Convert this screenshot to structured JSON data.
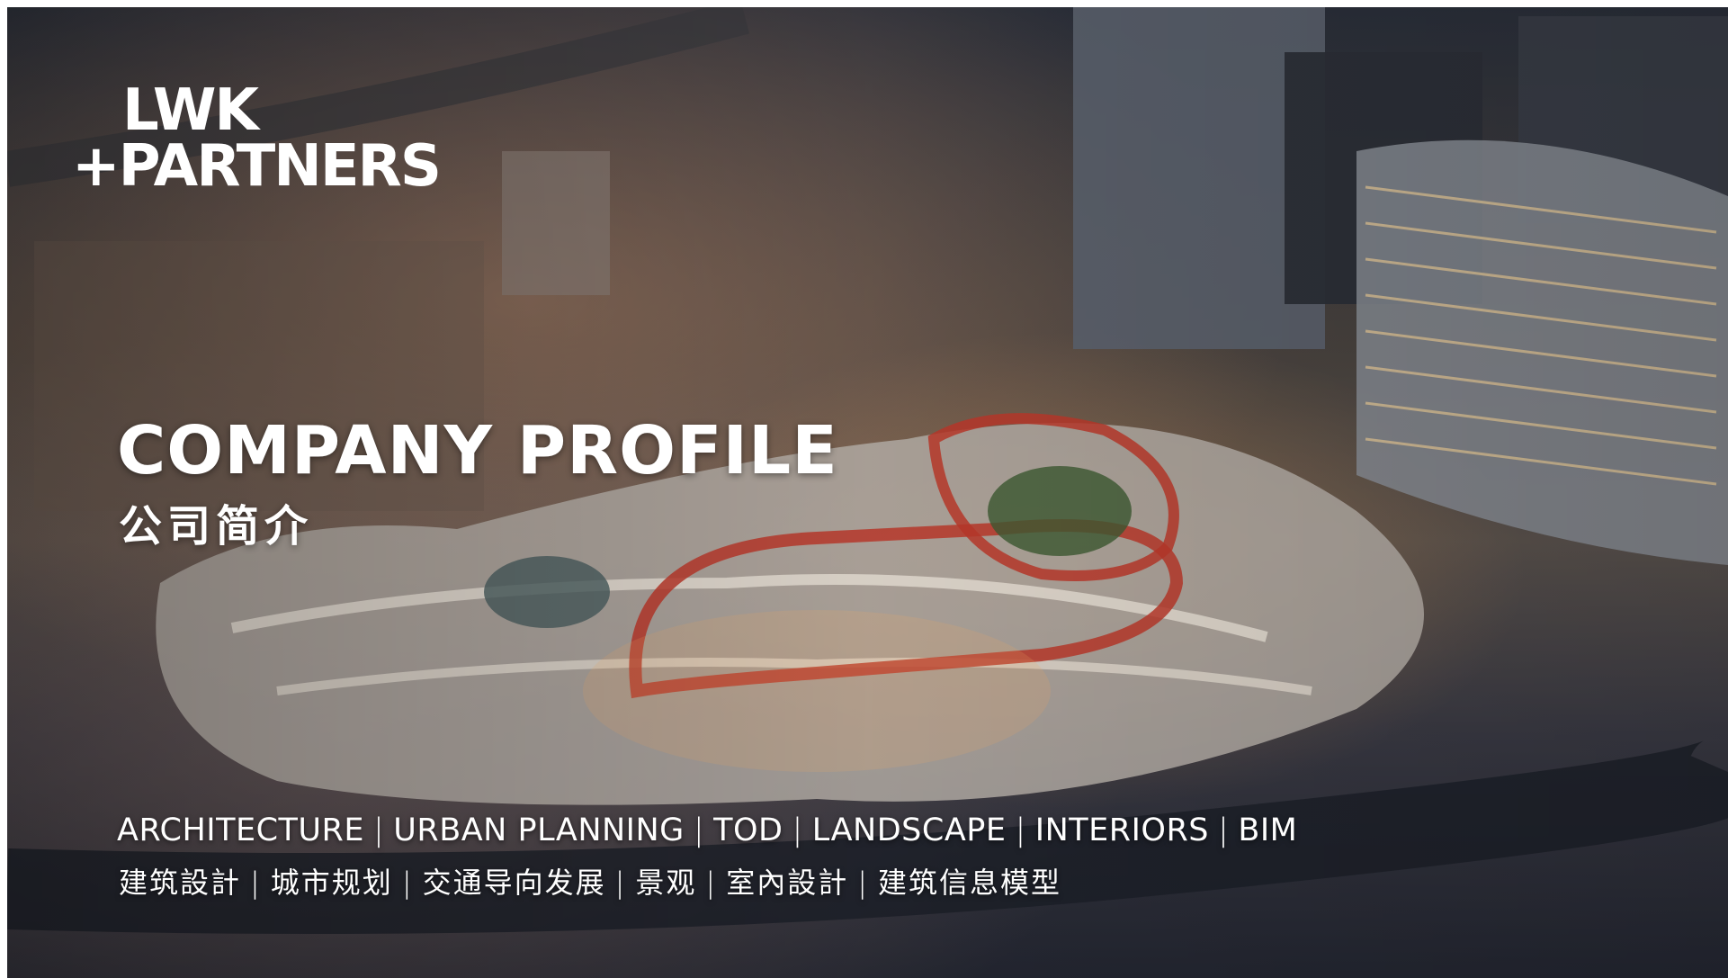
{
  "logo": {
    "line1": "LWK",
    "line2": "+PARTNERS"
  },
  "title": "COMPANY PROFILE",
  "subtitle_cn": "公司简介",
  "services_en": [
    "ARCHITECTURE",
    "URBAN PLANNING",
    "TOD",
    "LANDSCAPE",
    "INTERIORS",
    "BIM"
  ],
  "services_cn": [
    "建筑設計",
    "城市规划",
    "交通导向发展",
    "景观",
    "室內設計",
    "建筑信息模型"
  ],
  "separator": "|",
  "background": {
    "subject": "aerial-city-photo",
    "accent": "#c0392b"
  }
}
